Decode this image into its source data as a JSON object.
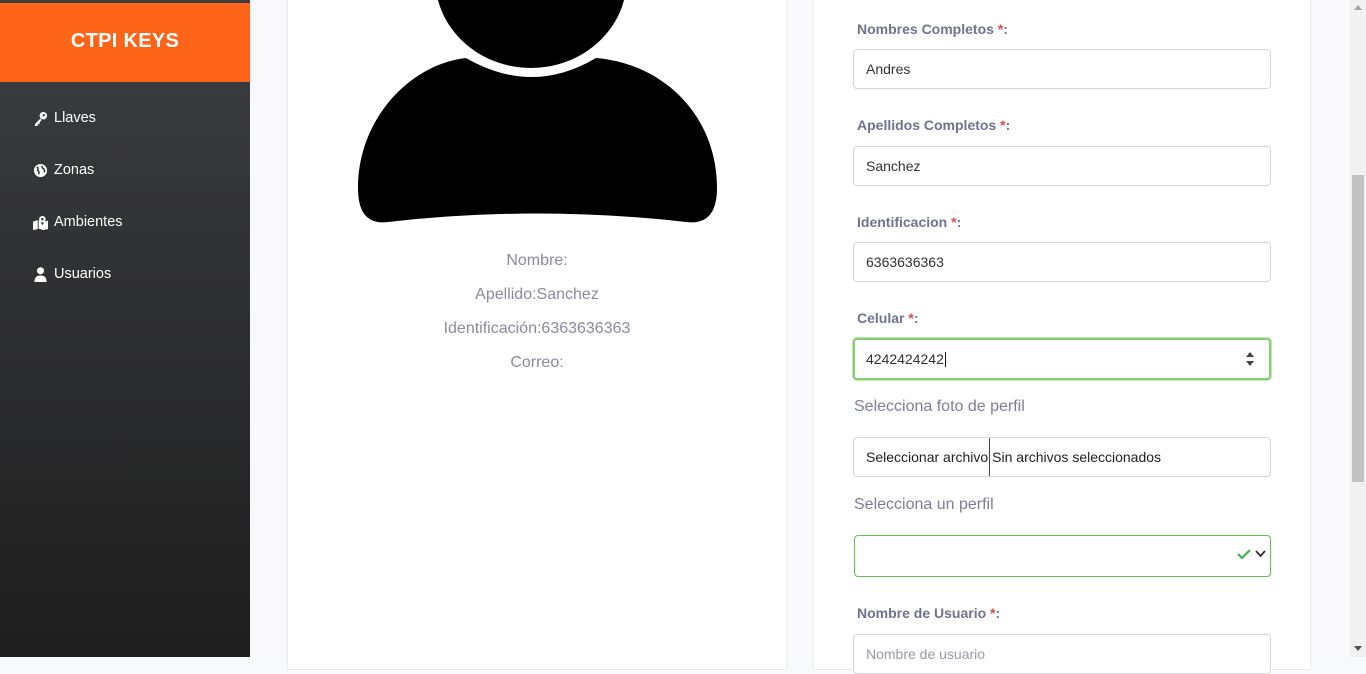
{
  "brand": {
    "title": "CTPI KEYS",
    "color": "#fe6518"
  },
  "sidebar": {
    "items": [
      {
        "label": "Llaves",
        "icon": "key-icon"
      },
      {
        "label": "Zonas",
        "icon": "globe-icon"
      },
      {
        "label": "Ambientes",
        "icon": "map-icon"
      },
      {
        "label": "Usuarios",
        "icon": "user-icon"
      }
    ]
  },
  "profile": {
    "nombre": "Nombre:",
    "apellido": "Apellido:Sanchez",
    "identificacion": "Identificación:6363636363",
    "correo": "Correo:"
  },
  "form": {
    "nombres_label": "Nombres Completos",
    "nombres_value": "Andres",
    "apellidos_label": "Apellidos Completos",
    "apellidos_value": "Sanchez",
    "identificacion_label": "Identificacion",
    "identificacion_value": "6363636363",
    "celular_label": "Celular",
    "celular_value": "4242424242",
    "foto_label": "Selecciona foto de perfil",
    "file_button": "Seleccionar archivo",
    "file_status": "Sin archivos seleccionados",
    "perfil_label": "Selecciona un perfil",
    "perfil_value": "",
    "usuario_label": "Nombre de Usuario",
    "usuario_placeholder": "Nombre de usuario",
    "required_mark": "*",
    "colon": ":"
  }
}
